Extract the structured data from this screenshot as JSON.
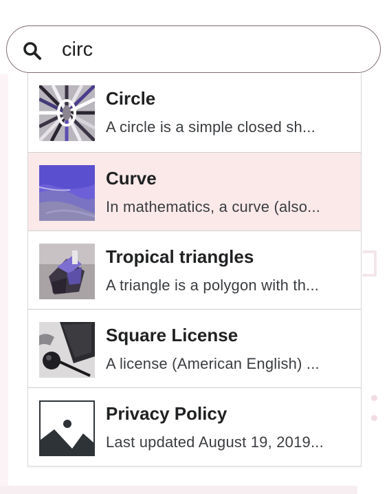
{
  "search": {
    "value": "circ",
    "icon": "search-icon"
  },
  "results": [
    {
      "title": "Circle",
      "description": "A circle is a simple closed sh...",
      "thumbnail": "circle-pattern-image",
      "highlighted": false
    },
    {
      "title": "Curve",
      "description": "In mathematics, a curve (also...",
      "thumbnail": "purple-abstract-image",
      "highlighted": true
    },
    {
      "title": "Tropical triangles",
      "description": "A triangle is a polygon with th...",
      "thumbnail": "sculpture-photo-image",
      "highlighted": false
    },
    {
      "title": "Square License",
      "description": "A license (American English) ...",
      "thumbnail": "desk-items-photo-image",
      "highlighted": false
    },
    {
      "title": "Privacy Policy",
      "description": "Last updated August 19, 2019...",
      "thumbnail": "image-placeholder-icon",
      "highlighted": false
    }
  ],
  "colors": {
    "highlight": "#fbe9ea",
    "border": "#7a6a6e",
    "title": "#202122"
  }
}
